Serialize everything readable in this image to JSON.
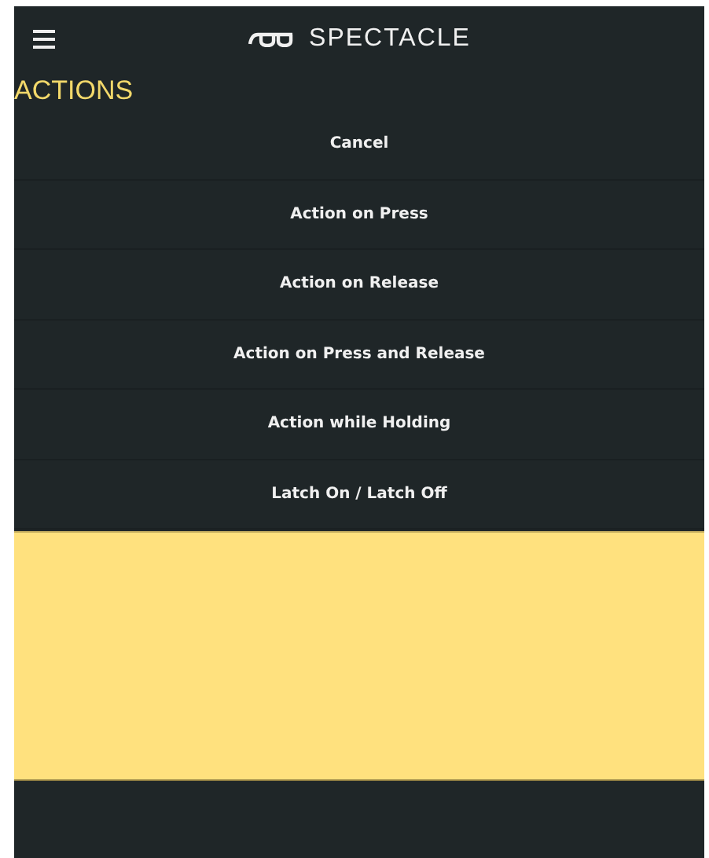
{
  "header": {
    "title": "SPECTACLE"
  },
  "section": {
    "title": "ACTIONS"
  },
  "actions": [
    {
      "label": "Cancel"
    },
    {
      "label": "Action on Press"
    },
    {
      "label": "Action on Release"
    },
    {
      "label": "Action on Press and Release"
    },
    {
      "label": "Action while Holding"
    },
    {
      "label": "Latch On / Latch Off"
    }
  ]
}
